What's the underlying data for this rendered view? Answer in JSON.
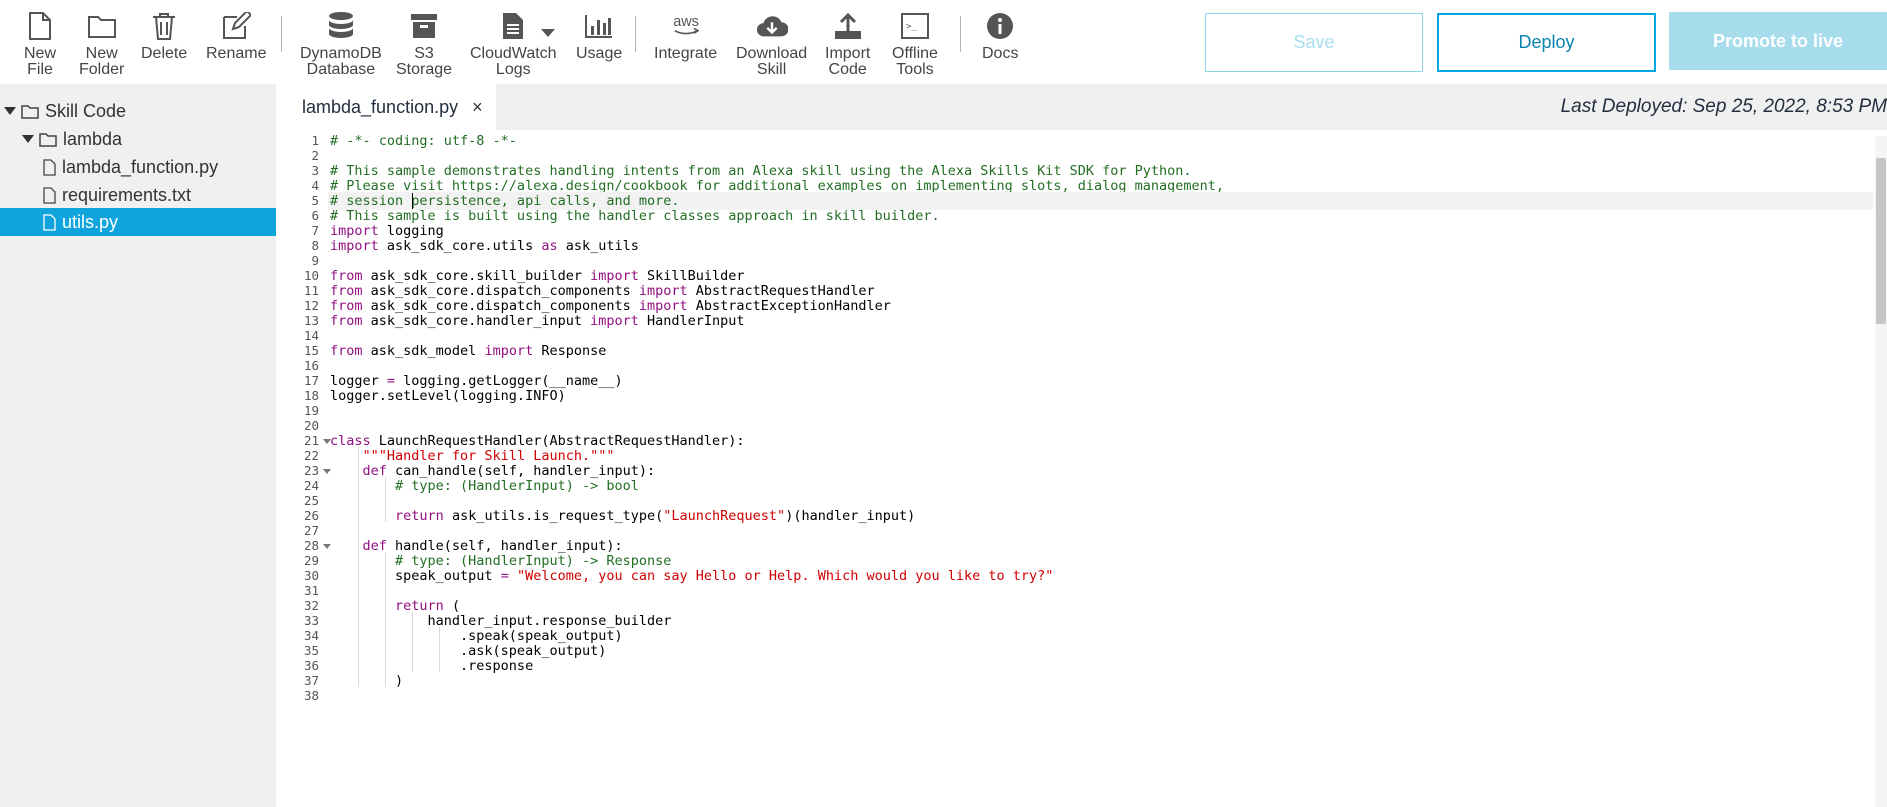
{
  "toolbar": {
    "new_file": "New\nFile",
    "new_folder": "New\nFolder",
    "delete": "Delete",
    "rename": "Rename",
    "dynamodb": "DynamoDB\nDatabase",
    "s3": "S3\nStorage",
    "cloudwatch": "CloudWatch\nLogs",
    "usage": "Usage",
    "integrate": "Integrate",
    "download": "Download\nSkill",
    "import": "Import\nCode",
    "offline": "Offline\nTools",
    "docs": "Docs",
    "aws_glyph": "aws",
    "offline_glyph": ">_"
  },
  "actions": {
    "save": "Save",
    "deploy": "Deploy",
    "promote": "Promote to live"
  },
  "tree": {
    "root": "Skill Code",
    "folder": "lambda",
    "files": [
      "lambda_function.py",
      "requirements.txt",
      "utils.py"
    ],
    "selected": "utils.py"
  },
  "editor": {
    "tab": "lambda_function.py",
    "close": "×",
    "last_deployed": "Last Deployed: Sep 25, 2022, 8:53 PM",
    "line_numbers": [
      "1",
      "2",
      "3",
      "4",
      "5",
      "6",
      "7",
      "8",
      "9",
      "10",
      "11",
      "12",
      "13",
      "14",
      "15",
      "16",
      "17",
      "18",
      "19",
      "20",
      "21",
      "22",
      "23",
      "24",
      "25",
      "26",
      "27",
      "28",
      "29",
      "30",
      "31",
      "32",
      "33",
      "34",
      "35",
      "36",
      "37",
      "38"
    ],
    "lines": [
      [
        {
          "t": "# -*- coding: utf-8 -*-",
          "c": "comment"
        }
      ],
      [],
      [
        {
          "t": "# This sample demonstrates handling intents from an Alexa skill using the Alexa Skills Kit SDK for Python.",
          "c": "comment"
        }
      ],
      [
        {
          "t": "# Please visit https://alexa.design/cookbook for additional examples on implementing slots, dialog management,",
          "c": "comment"
        }
      ],
      [
        {
          "t": "# session persistence, api calls, and more.",
          "c": "comment"
        }
      ],
      [
        {
          "t": "# This sample is built using the handler classes approach in skill builder.",
          "c": "comment"
        }
      ],
      [
        {
          "t": "import",
          "c": "kw"
        },
        {
          "t": " logging"
        }
      ],
      [
        {
          "t": "import",
          "c": "kw"
        },
        {
          "t": " ask_sdk_core.utils "
        },
        {
          "t": "as",
          "c": "kw"
        },
        {
          "t": " ask_utils"
        }
      ],
      [],
      [
        {
          "t": "from",
          "c": "kw"
        },
        {
          "t": " ask_sdk_core.skill_builder "
        },
        {
          "t": "import",
          "c": "kw"
        },
        {
          "t": " SkillBuilder"
        }
      ],
      [
        {
          "t": "from",
          "c": "kw"
        },
        {
          "t": " ask_sdk_core.dispatch_components "
        },
        {
          "t": "import",
          "c": "kw"
        },
        {
          "t": " AbstractRequestHandler"
        }
      ],
      [
        {
          "t": "from",
          "c": "kw"
        },
        {
          "t": " ask_sdk_core.dispatch_components "
        },
        {
          "t": "import",
          "c": "kw"
        },
        {
          "t": " AbstractExceptionHandler"
        }
      ],
      [
        {
          "t": "from",
          "c": "kw"
        },
        {
          "t": " ask_sdk_core.handler_input "
        },
        {
          "t": "import",
          "c": "kw"
        },
        {
          "t": " HandlerInput"
        }
      ],
      [],
      [
        {
          "t": "from",
          "c": "kw"
        },
        {
          "t": " ask_sdk_model "
        },
        {
          "t": "import",
          "c": "kw"
        },
        {
          "t": " Response"
        }
      ],
      [],
      [
        {
          "t": "logger "
        },
        {
          "t": "=",
          "c": "kw"
        },
        {
          "t": " logging.getLogger(__name__)"
        }
      ],
      [
        {
          "t": "logger.setLevel(logging.INFO)"
        }
      ],
      [],
      [],
      [
        {
          "t": "class",
          "c": "kw"
        },
        {
          "t": " LaunchRequestHandler(AbstractRequestHandler):"
        }
      ],
      [
        {
          "t": "    "
        },
        {
          "t": "\"\"\"Handler for Skill Launch.\"\"\"",
          "c": "str"
        }
      ],
      [
        {
          "t": "    "
        },
        {
          "t": "def",
          "c": "kw"
        },
        {
          "t": " can_handle(self, handler_input):"
        }
      ],
      [
        {
          "t": "        "
        },
        {
          "t": "# type: (HandlerInput) -> bool",
          "c": "comment"
        }
      ],
      [],
      [
        {
          "t": "        "
        },
        {
          "t": "return",
          "c": "kw"
        },
        {
          "t": " ask_utils.is_request_type("
        },
        {
          "t": "\"LaunchRequest\"",
          "c": "str"
        },
        {
          "t": ")(handler_input)"
        }
      ],
      [],
      [
        {
          "t": "    "
        },
        {
          "t": "def",
          "c": "kw"
        },
        {
          "t": " handle(self, handler_input):"
        }
      ],
      [
        {
          "t": "        "
        },
        {
          "t": "# type: (HandlerInput) -> Response",
          "c": "comment"
        }
      ],
      [
        {
          "t": "        speak_output "
        },
        {
          "t": "=",
          "c": "kw"
        },
        {
          "t": " "
        },
        {
          "t": "\"Welcome, you can say Hello or Help. Which would you like to try?\"",
          "c": "str"
        }
      ],
      [],
      [
        {
          "t": "        "
        },
        {
          "t": "return",
          "c": "kw"
        },
        {
          "t": " ("
        }
      ],
      [
        {
          "t": "            handler_input.response_builder"
        }
      ],
      [
        {
          "t": "                .speak(speak_output)"
        }
      ],
      [
        {
          "t": "                .ask(speak_output)"
        }
      ],
      [
        {
          "t": "                .response"
        }
      ],
      [
        {
          "t": "        )"
        }
      ],
      []
    ]
  }
}
